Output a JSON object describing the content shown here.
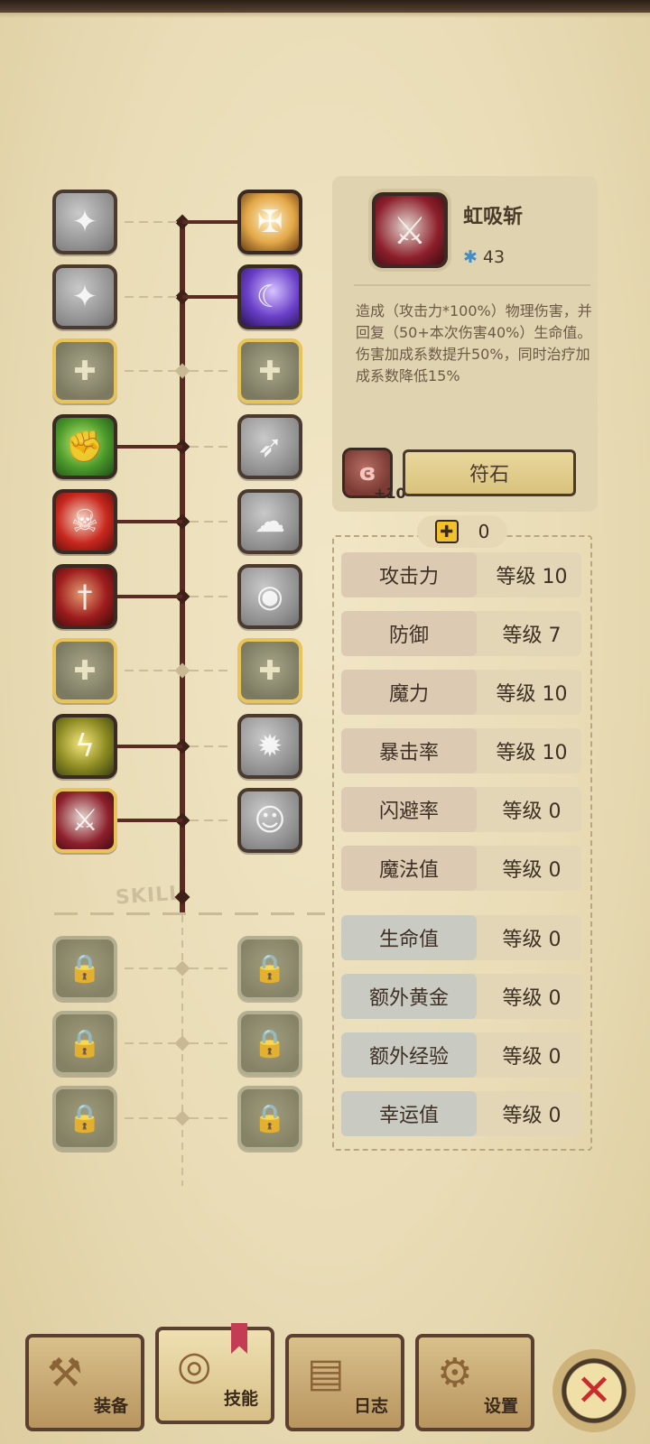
{
  "tree": {
    "watermark": "SKILL",
    "left_column": [
      {
        "name": "slash-skill-icon",
        "style": "grey",
        "glyph": "✦"
      },
      {
        "name": "dash-strike-skill-icon",
        "style": "grey",
        "glyph": "✦"
      },
      {
        "name": "empty-slot-icon",
        "style": "empty",
        "glyph": "✚"
      },
      {
        "name": "strength-skill-icon",
        "style": "green",
        "glyph": "✊"
      },
      {
        "name": "reaper-skill-icon",
        "style": "red",
        "glyph": "☠"
      },
      {
        "name": "dagger-skill-icon",
        "style": "darkred",
        "glyph": "†"
      },
      {
        "name": "empty-slot-icon",
        "style": "empty",
        "glyph": "✚"
      },
      {
        "name": "lightning-skill-icon",
        "style": "olive",
        "glyph": "ϟ"
      },
      {
        "name": "vampiric-slash-skill-icon",
        "style": "sword",
        "glyph": "⚔"
      },
      {
        "name": "locked-skill-icon",
        "style": "locked",
        "glyph": "🔒"
      },
      {
        "name": "locked-skill-icon",
        "style": "locked",
        "glyph": "🔒"
      },
      {
        "name": "locked-skill-icon",
        "style": "locked",
        "glyph": "🔒"
      }
    ],
    "right_column": [
      {
        "name": "holy-shield-skill-icon",
        "style": "gold",
        "glyph": "✠"
      },
      {
        "name": "shadow-skill-icon",
        "style": "purple",
        "glyph": "☾"
      },
      {
        "name": "empty-slot-icon",
        "style": "empty",
        "glyph": "✚"
      },
      {
        "name": "rush-skill-icon",
        "style": "grey",
        "glyph": "➶"
      },
      {
        "name": "smoke-skill-icon",
        "style": "grey",
        "glyph": "☁"
      },
      {
        "name": "eye-skill-icon",
        "style": "grey",
        "glyph": "◉"
      },
      {
        "name": "empty-slot-icon",
        "style": "empty",
        "glyph": "✚"
      },
      {
        "name": "bomb-skill-icon",
        "style": "grey",
        "glyph": "✹"
      },
      {
        "name": "spirit-skill-icon",
        "style": "grey",
        "glyph": "☺"
      },
      {
        "name": "locked-skill-icon",
        "style": "locked",
        "glyph": "🔒"
      },
      {
        "name": "locked-skill-icon",
        "style": "locked",
        "glyph": "🔒"
      },
      {
        "name": "locked-skill-icon",
        "style": "locked",
        "glyph": "🔒"
      }
    ]
  },
  "detail": {
    "icon": "vampiric-slash-icon",
    "icon_glyph": "⚔",
    "name": "虹吸斩",
    "cost_icon": "gear-icon",
    "cost_glyph": "✱",
    "cost": "43",
    "description": "造成（攻击力*100%）物理伤害，并回复（50+本次伤害40%）生命值。\n伤害加成系数提升50%，同时治疗加成系数降低15%",
    "rune_icon": "rune-stone-icon",
    "rune_glyph": "ɞ",
    "rune_level": "+10",
    "rune_button": "符石"
  },
  "points": {
    "icon": "plus-icon",
    "glyph": "✚",
    "value": "0"
  },
  "stats": [
    {
      "label": "攻击力",
      "value": "等级 10",
      "tone": "warm"
    },
    {
      "label": "防御",
      "value": "等级 7",
      "tone": "warm"
    },
    {
      "label": "魔力",
      "value": "等级 10",
      "tone": "warm"
    },
    {
      "label": "暴击率",
      "value": "等级 10",
      "tone": "warm"
    },
    {
      "label": "闪避率",
      "value": "等级 0",
      "tone": "warm"
    },
    {
      "label": "魔法值",
      "value": "等级 0",
      "tone": "warm"
    },
    {
      "label": "生命值",
      "value": "等级 0",
      "tone": "cool"
    },
    {
      "label": "额外黄金",
      "value": "等级 0",
      "tone": "cool"
    },
    {
      "label": "额外经验",
      "value": "等级 0",
      "tone": "cool"
    },
    {
      "label": "幸运值",
      "value": "等级 0",
      "tone": "cool"
    }
  ],
  "tabs": [
    {
      "label": "装备",
      "icon": "axe-icon",
      "glyph": "⚒",
      "active": false
    },
    {
      "label": "技能",
      "icon": "skill-ring-icon",
      "glyph": "◎",
      "active": true
    },
    {
      "label": "日志",
      "icon": "journal-icon",
      "glyph": "▤",
      "active": false
    },
    {
      "label": "设置",
      "icon": "gear-icon",
      "glyph": "⚙",
      "active": false
    }
  ],
  "close": {
    "icon": "close-icon",
    "glyph": "✕"
  }
}
